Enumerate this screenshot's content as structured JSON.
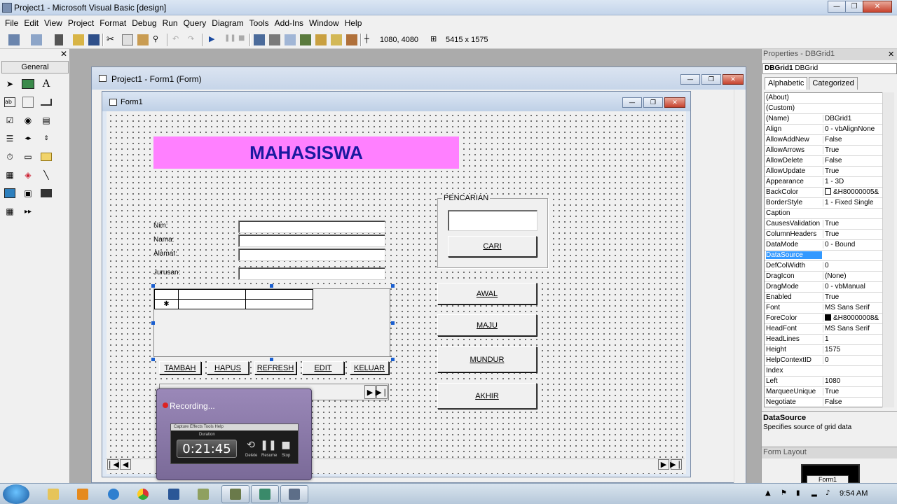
{
  "window": {
    "title": "Project1 - Microsoft Visual Basic [design]"
  },
  "menu": [
    "File",
    "Edit",
    "View",
    "Project",
    "Format",
    "Debug",
    "Run",
    "Query",
    "Diagram",
    "Tools",
    "Add-Ins",
    "Window",
    "Help"
  ],
  "toolbar": {
    "position_readout": "1080, 4080",
    "size_readout": "5415 x 1575"
  },
  "toolbox": {
    "tab_label": "General",
    "tools": [
      "pointer-icon",
      "picturebox-icon",
      "label-icon",
      "textbox-icon",
      "frame-icon",
      "commandbutton-icon",
      "checkbox-icon",
      "optionbutton-icon",
      "combobox-icon",
      "listbox-icon",
      "hscrollbar-icon",
      "vscrollbar-icon",
      "timer-icon",
      "drivelistbox-icon",
      "dirlistbox-icon",
      "filelistbox-icon",
      "shape-icon",
      "line-icon",
      "image-icon",
      "data-icon",
      "ole-icon",
      "dbgrid-icon",
      "adodc-icon"
    ]
  },
  "project_window": {
    "title": "Project1 - Form1 (Form)"
  },
  "form": {
    "title": "Form1",
    "header": "MAHASISWA",
    "labels": {
      "nim": "Nim:",
      "nama": "Nama:",
      "alamat": "Alamat:",
      "jurusan": "Jurusan:"
    },
    "frame_label": "PENCARIAN",
    "buttons": {
      "cari": "CARI",
      "awal": "AWAL",
      "maju": "MAJU",
      "mundur": "MUNDUR",
      "akhir": "AKHIR",
      "tambah": "TAMBAH",
      "hapus": "HAPUS",
      "refresh": "REFRESH",
      "edit": "EDIT",
      "keluar": "KELUAR"
    },
    "grid": {
      "new_row_marker": "✱"
    }
  },
  "recording": {
    "status": "Recording...",
    "menu": "Capture   Effects   Tools   Help",
    "duration_label": "Duration",
    "time": "0:21:45",
    "controls": [
      "Delete",
      "Resume",
      "Stop"
    ]
  },
  "properties": {
    "header": "Properties - DBGrid1",
    "object_name": "DBGrid1",
    "object_type": "DBGrid",
    "tabs": [
      "Alphabetic",
      "Categorized"
    ],
    "rows": [
      {
        "name": "(About)",
        "value": ""
      },
      {
        "name": "(Custom)",
        "value": ""
      },
      {
        "name": "(Name)",
        "value": "DBGrid1"
      },
      {
        "name": "Align",
        "value": "0 - vbAlignNone"
      },
      {
        "name": "AllowAddNew",
        "value": "False"
      },
      {
        "name": "AllowArrows",
        "value": "True"
      },
      {
        "name": "AllowDelete",
        "value": "False"
      },
      {
        "name": "AllowUpdate",
        "value": "True"
      },
      {
        "name": "Appearance",
        "value": "1 - 3D"
      },
      {
        "name": "BackColor",
        "value": "&H80000005&",
        "swatch": "#ffffff"
      },
      {
        "name": "BorderStyle",
        "value": "1 - Fixed Single"
      },
      {
        "name": "Caption",
        "value": ""
      },
      {
        "name": "CausesValidation",
        "value": "True"
      },
      {
        "name": "ColumnHeaders",
        "value": "True"
      },
      {
        "name": "DataMode",
        "value": "0 - Bound"
      },
      {
        "name": "DataSource",
        "value": "",
        "selected": true
      },
      {
        "name": "DefColWidth",
        "value": "0"
      },
      {
        "name": "DragIcon",
        "value": "(None)"
      },
      {
        "name": "DragMode",
        "value": "0 - vbManual"
      },
      {
        "name": "Enabled",
        "value": "True"
      },
      {
        "name": "Font",
        "value": "MS Sans Serif"
      },
      {
        "name": "ForeColor",
        "value": "&H80000008&",
        "swatch": "#000000"
      },
      {
        "name": "HeadFont",
        "value": "MS Sans Serif"
      },
      {
        "name": "HeadLines",
        "value": "1"
      },
      {
        "name": "Height",
        "value": "1575"
      },
      {
        "name": "HelpContextID",
        "value": "0"
      },
      {
        "name": "Index",
        "value": ""
      },
      {
        "name": "Left",
        "value": "1080"
      },
      {
        "name": "MarqueeUnique",
        "value": "True"
      },
      {
        "name": "Negotiate",
        "value": "False"
      }
    ],
    "description_title": "DataSource",
    "description_text": "Specifies source of grid data"
  },
  "form_layout": {
    "header": "Form Layout",
    "form_label": "Form1"
  },
  "taskbar": {
    "clock": "9:54 AM"
  }
}
